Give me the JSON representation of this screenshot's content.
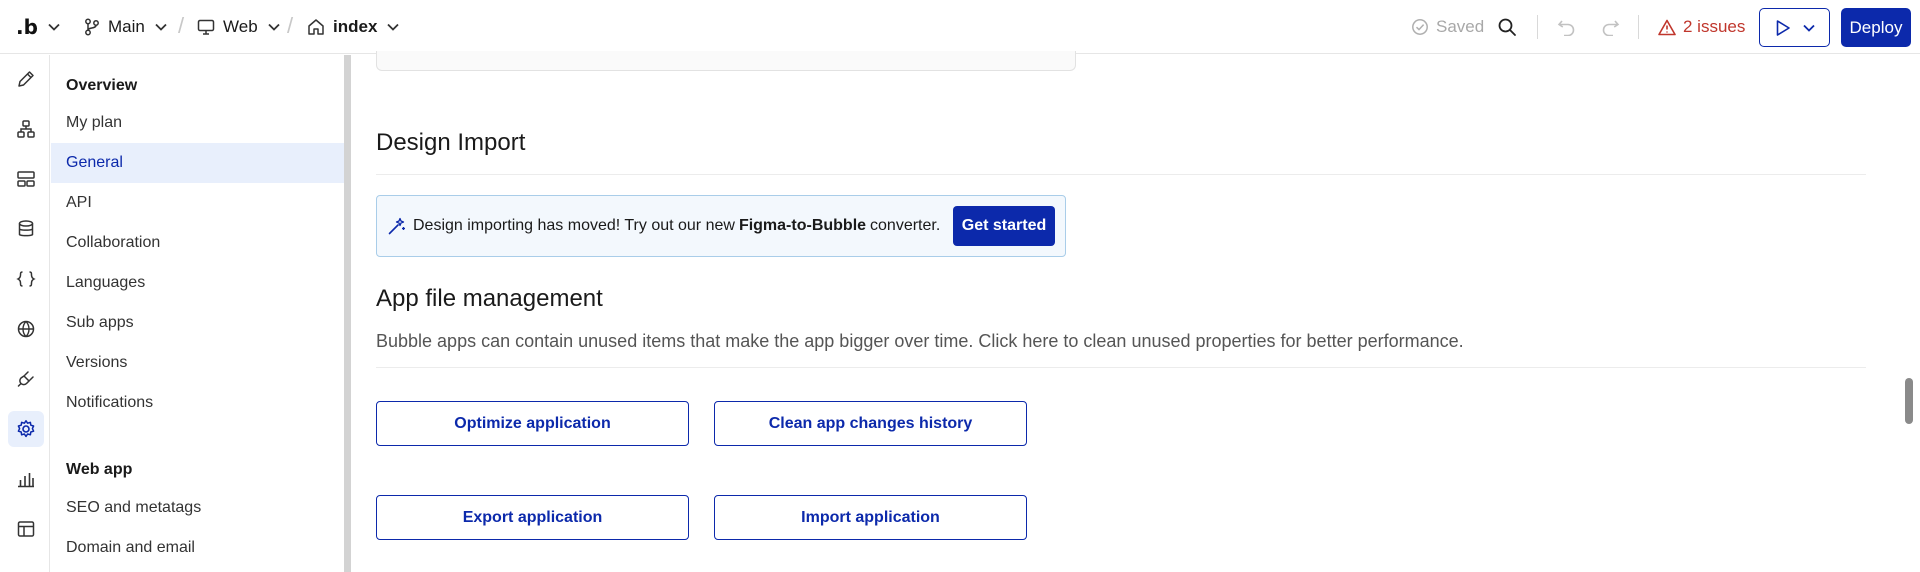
{
  "topbar": {
    "logo": ".b",
    "branch": "Main",
    "platform": "Web",
    "page": "index",
    "saved": "Saved",
    "issues": "2 issues",
    "deploy": "Deploy"
  },
  "nav": {
    "overview_heading": "Overview",
    "overview_items": [
      "My plan",
      "General",
      "API",
      "Collaboration",
      "Languages",
      "Sub apps",
      "Versions",
      "Notifications"
    ],
    "active_item": "General",
    "webapp_heading": "Web app",
    "webapp_items": [
      "SEO and metatags",
      "Domain and email"
    ]
  },
  "rail": {
    "icons": [
      "design-icon",
      "workflow-icon",
      "styles-icon",
      "data-icon",
      "code-icon",
      "globe-icon",
      "plugins-icon",
      "settings-icon",
      "logs-icon",
      "layout-icon"
    ],
    "active": "settings-icon"
  },
  "design_import": {
    "title": "Design Import",
    "banner_pre": "Design importing has moved! Try out our new",
    "banner_bold": "Figma-to-Bubble",
    "banner_post": "converter.",
    "cta": "Get started"
  },
  "file_management": {
    "title": "App file management",
    "description": "Bubble apps can contain unused items that make the app bigger over time. Click here to clean unused properties for better performance.",
    "buttons": {
      "optimize": "Optimize application",
      "clean_history": "Clean app changes history",
      "export": "Export application",
      "import": "Import application"
    }
  },
  "colors": {
    "brand": "#0c29ab",
    "active_bg": "#e8effc",
    "issue": "#c0362c"
  }
}
